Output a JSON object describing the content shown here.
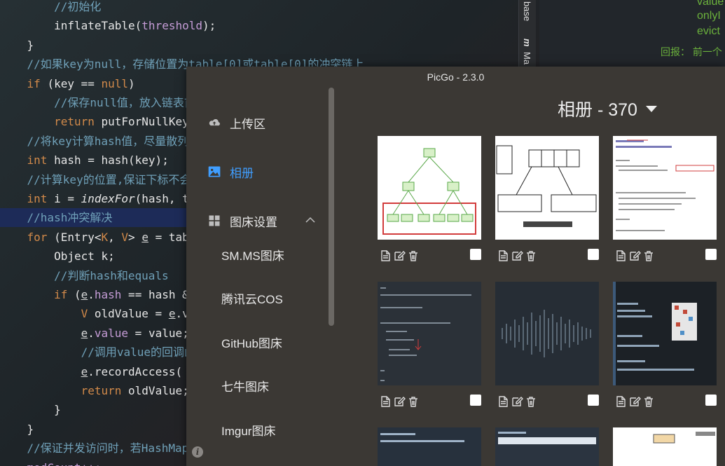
{
  "editor": {
    "lines": [
      {
        "segments": [
          {
            "t": "        //初始化",
            "c": "c-comment"
          }
        ]
      },
      {
        "segments": [
          {
            "t": "        inflateTable(",
            "c": "c-fn"
          },
          {
            "t": "threshold",
            "c": "c-id"
          },
          {
            "t": ");",
            "c": "c-fn"
          }
        ]
      },
      {
        "segments": [
          {
            "t": "    }",
            "c": "c-fn"
          }
        ]
      },
      {
        "segments": [
          {
            "t": "    //如果key为null，存储位置为table[0]或table[0]的冲突链上",
            "c": "c-comment"
          }
        ]
      },
      {
        "segments": [
          {
            "t": "    if ",
            "c": "c-kw"
          },
          {
            "t": "(key == ",
            "c": "c-fn"
          },
          {
            "t": "null",
            "c": "c-kw"
          },
          {
            "t": ")",
            "c": "c-fn"
          }
        ]
      },
      {
        "segments": [
          {
            "t": "        //保存null值，放入链表首",
            "c": "c-comment"
          }
        ]
      },
      {
        "segments": [
          {
            "t": "        return ",
            "c": "c-kw"
          },
          {
            "t": "putForNullKey",
            "c": "c-fn"
          }
        ]
      },
      {
        "segments": [
          {
            "t": "    //将key计算hash值，尽量散列",
            "c": "c-comment"
          }
        ]
      },
      {
        "segments": [
          {
            "t": "    int ",
            "c": "c-kw"
          },
          {
            "t": "hash = hash(key);",
            "c": "c-fn"
          }
        ]
      },
      {
        "segments": [
          {
            "t": "    //计算key的位置,保证下标不会",
            "c": "c-comment"
          }
        ]
      },
      {
        "segments": [
          {
            "t": "    int ",
            "c": "c-kw"
          },
          {
            "t": "i = ",
            "c": "c-fn"
          },
          {
            "t": "indexFor",
            "c": "c-it"
          },
          {
            "t": "(hash, t",
            "c": "c-fn"
          }
        ]
      },
      {
        "segments": [
          {
            "t": "    //hash冲突解决",
            "c": "c-comment"
          }
        ],
        "highlight": true
      },
      {
        "segments": [
          {
            "t": "    for ",
            "c": "c-kw"
          },
          {
            "t": "(Entry<",
            "c": "c-fn"
          },
          {
            "t": "K",
            "c": "c-kw"
          },
          {
            "t": ", ",
            "c": "c-fn"
          },
          {
            "t": "V",
            "c": "c-kw"
          },
          {
            "t": "> ",
            "c": "c-fn"
          },
          {
            "t": "e",
            "c": "c-ul"
          },
          {
            "t": " = tab",
            "c": "c-fn"
          }
        ]
      },
      {
        "segments": [
          {
            "t": "        Object k;",
            "c": "c-fn"
          }
        ]
      },
      {
        "segments": [
          {
            "t": "        //判断hash和equals",
            "c": "c-comment"
          }
        ]
      },
      {
        "segments": [
          {
            "t": "        if ",
            "c": "c-kw"
          },
          {
            "t": "(",
            "c": "c-fn"
          },
          {
            "t": "e",
            "c": "c-ul"
          },
          {
            "t": ".",
            "c": "c-fn"
          },
          {
            "t": "hash",
            "c": "c-id"
          },
          {
            "t": " == hash &",
            "c": "c-fn"
          }
        ]
      },
      {
        "segments": [
          {
            "t": "            V ",
            "c": "c-kw"
          },
          {
            "t": "oldValue = ",
            "c": "c-fn"
          },
          {
            "t": "e",
            "c": "c-ul"
          },
          {
            "t": ".v",
            "c": "c-fn"
          }
        ]
      },
      {
        "segments": [
          {
            "t": "            ",
            "c": "c-fn"
          },
          {
            "t": "e",
            "c": "c-ul"
          },
          {
            "t": ".",
            "c": "c-fn"
          },
          {
            "t": "value",
            "c": "c-id"
          },
          {
            "t": " = value;",
            "c": "c-fn"
          }
        ]
      },
      {
        "segments": [
          {
            "t": "            //调用value的回调函",
            "c": "c-comment"
          }
        ]
      },
      {
        "segments": [
          {
            "t": "            ",
            "c": "c-fn"
          },
          {
            "t": "e",
            "c": "c-ul"
          },
          {
            "t": ".recordAccess(",
            "c": "c-fn"
          }
        ]
      },
      {
        "segments": [
          {
            "t": "            return ",
            "c": "c-kw"
          },
          {
            "t": "oldValue;",
            "c": "c-fn"
          }
        ]
      },
      {
        "segments": [
          {
            "t": "        }",
            "c": "c-fn"
          }
        ]
      },
      {
        "segments": [
          {
            "t": "    }",
            "c": "c-fn"
          }
        ]
      },
      {
        "segments": [
          {
            "t": "    //保证并发访问时，若HashMap",
            "c": "c-comment"
          }
        ]
      },
      {
        "segments": [
          {
            "t": "    modCount++;",
            "c": "c-id"
          }
        ]
      }
    ],
    "right_tab_1": "base",
    "right_tab_2": "Ma",
    "right_lines": [
      "value",
      "onlyI",
      "evict"
    ],
    "right_reply": "回报：  前一个"
  },
  "picgo": {
    "window_title": "PicGo - 2.3.0",
    "nav": {
      "upload_label": "上传区",
      "album_label": "相册",
      "settings_label": "图床设置"
    },
    "sub_items": [
      "SM.MS图床",
      "腾讯云COS",
      "GitHub图床",
      "七牛图床",
      "Imgur图床"
    ],
    "album_title": "相册 - 370",
    "info_glyph": "i",
    "accent_color": "#409eff"
  }
}
